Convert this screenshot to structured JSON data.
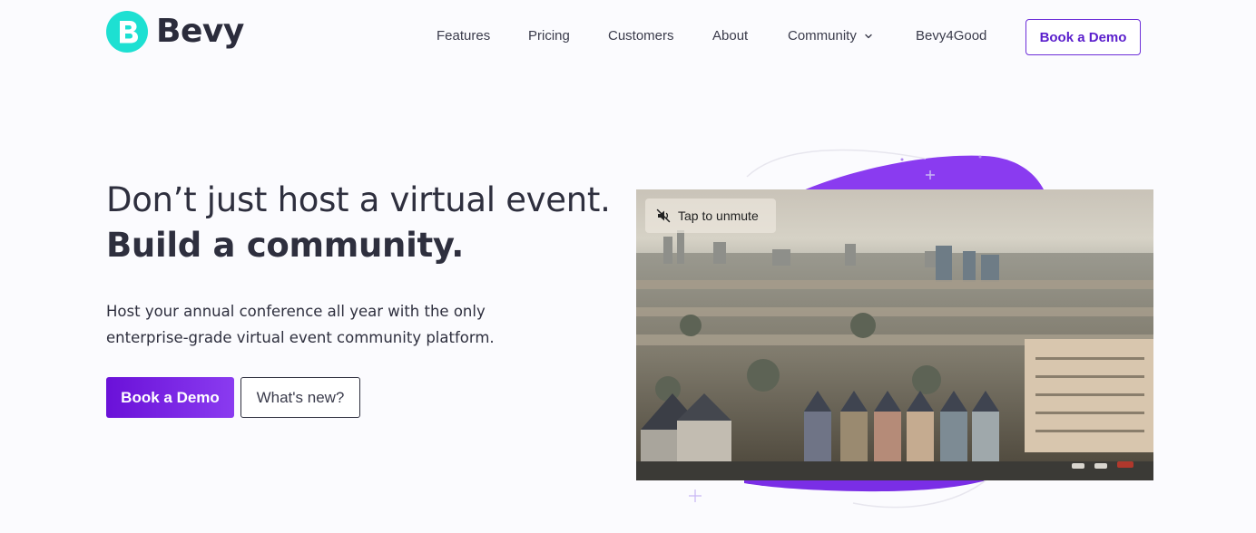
{
  "brand": {
    "name": "Bevy",
    "accent": "#6a11d8",
    "logo_color": "#1de0d2"
  },
  "nav": {
    "items": [
      "Features",
      "Pricing",
      "Customers",
      "About",
      "Community",
      "Bevy4Good"
    ],
    "cta_label": "Book a Demo"
  },
  "hero": {
    "title_regular": "Don’t just host a virtual event. ",
    "title_bold": "Build a community.",
    "subtitle": "Host your annual conference all year with the only enterprise-grade virtual event community platform.",
    "primary_button": "Book a Demo",
    "secondary_button": "What's new?"
  },
  "video": {
    "unmute_label": "Tap to unmute",
    "icon": "muted-speaker-icon"
  }
}
